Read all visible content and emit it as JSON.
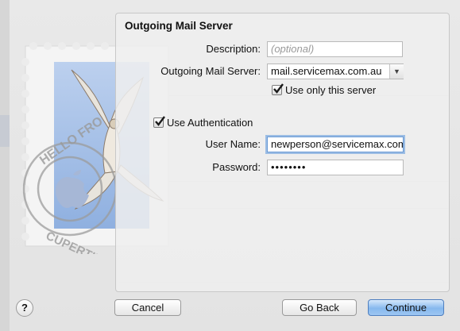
{
  "panel": {
    "title": "Outgoing Mail Server"
  },
  "form": {
    "description": {
      "label": "Description:",
      "placeholder": "(optional)",
      "value": ""
    },
    "server": {
      "label": "Outgoing Mail Server:",
      "value": "mail.servicemax.com.au"
    },
    "use_only": {
      "label": "Use only this server",
      "checked": true
    },
    "use_auth": {
      "label": "Use Authentication",
      "checked": true
    },
    "username": {
      "label": "User Name:",
      "value": "newperson@servicemax.com.au"
    },
    "password": {
      "label": "Password:",
      "value": "••••••••"
    }
  },
  "buttons": {
    "help": "?",
    "cancel": "Cancel",
    "go_back": "Go Back",
    "continue": "Continue"
  },
  "stamp": {
    "postmark_text": "HELLO FROM CUPERTINO CA"
  },
  "colors": {
    "accent": "#6b9bd6",
    "primary_button": "#86b8ee"
  }
}
